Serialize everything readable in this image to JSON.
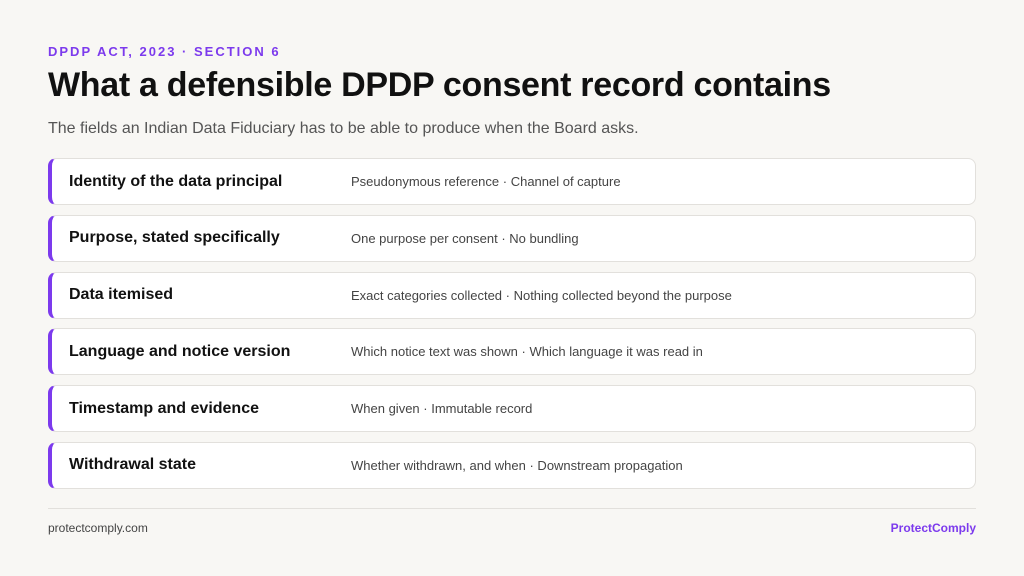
{
  "eyebrow": "DPDP ACT, 2023 · SECTION 6",
  "title": "What a defensible DPDP consent record contains",
  "subtitle": "The fields an Indian Data Fiduciary has to be able to produce when the Board asks.",
  "rows": [
    {
      "label": "Identity of the data principal",
      "detail": "Pseudonymous reference · Channel of capture"
    },
    {
      "label": "Purpose, stated specifically",
      "detail": "One purpose per consent · No bundling"
    },
    {
      "label": "Data itemised",
      "detail": "Exact categories collected · Nothing collected beyond the purpose"
    },
    {
      "label": "Language and notice version",
      "detail": "Which notice text was shown · Which language it was read in"
    },
    {
      "label": "Timestamp and evidence",
      "detail": "When given · Immutable record"
    },
    {
      "label": "Withdrawal state",
      "detail": "Whether withdrawn, and when · Downstream propagation"
    }
  ],
  "footer": {
    "website": "protectcomply.com",
    "brand": "ProtectComply"
  },
  "colors": {
    "accent": "#7c3aed",
    "background": "#f8f7f4"
  }
}
